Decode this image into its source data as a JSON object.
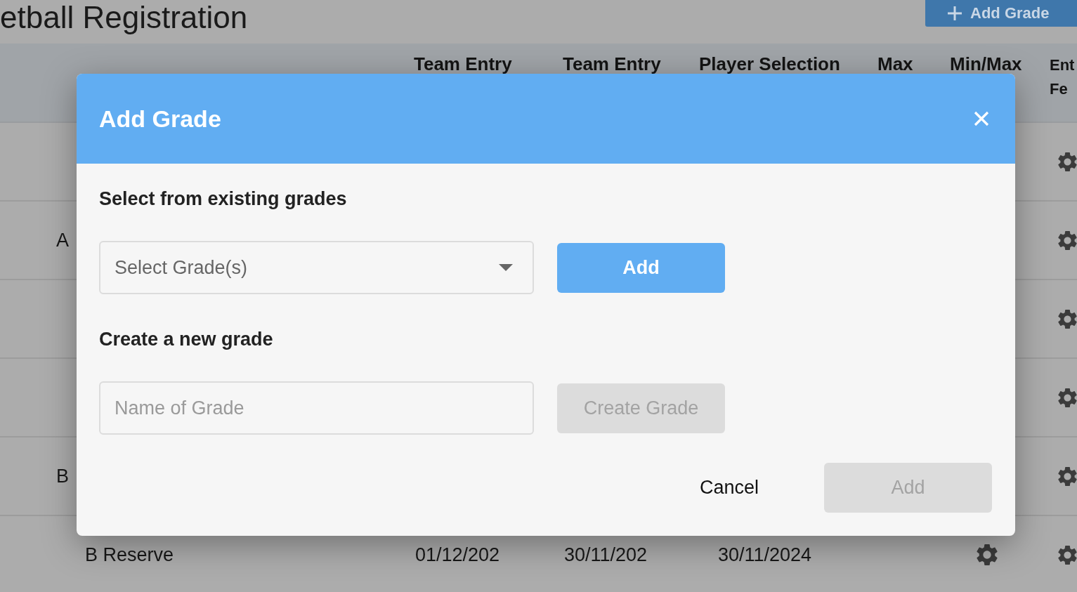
{
  "page": {
    "title": "etball Registration",
    "add_grade_button": {
      "label": "Add Grade"
    }
  },
  "table": {
    "columns": [
      {},
      {
        "lines": [
          "Team Entry"
        ]
      },
      {
        "lines": [
          "Team Entry"
        ]
      },
      {
        "lines": [
          "Player Selection"
        ]
      },
      {
        "lines": [
          "Max"
        ]
      },
      {
        "lines": [
          "Min/Max"
        ]
      },
      {
        "lines": [
          "Ent",
          "Fe"
        ]
      }
    ],
    "rows": [
      {
        "cells": [
          {
            "kind": "blank"
          },
          {
            "kind": "blank"
          },
          {
            "kind": "blank"
          },
          {
            "kind": "blank"
          },
          {
            "kind": "blank"
          },
          {
            "kind": "blank"
          },
          {
            "kind": "gear"
          }
        ]
      },
      {
        "kind": "group",
        "cells": [
          {
            "kind": "text",
            "text": "A"
          },
          {
            "kind": "blank"
          },
          {
            "kind": "blank"
          },
          {
            "kind": "blank"
          },
          {
            "kind": "blank"
          },
          {
            "kind": "blank"
          },
          {
            "kind": "gear"
          }
        ]
      },
      {
        "cells": [
          {
            "kind": "blank"
          },
          {
            "kind": "blank"
          },
          {
            "kind": "blank"
          },
          {
            "kind": "blank"
          },
          {
            "kind": "blank"
          },
          {
            "kind": "blank"
          },
          {
            "kind": "gear"
          }
        ]
      },
      {
        "cells": [
          {
            "kind": "blank"
          },
          {
            "kind": "blank"
          },
          {
            "kind": "blank"
          },
          {
            "kind": "blank"
          },
          {
            "kind": "blank"
          },
          {
            "kind": "blank"
          },
          {
            "kind": "gear"
          }
        ]
      },
      {
        "kind": "group",
        "cells": [
          {
            "kind": "text",
            "text": "B"
          },
          {
            "kind": "blank"
          },
          {
            "kind": "blank"
          },
          {
            "kind": "blank"
          },
          {
            "kind": "blank"
          },
          {
            "kind": "blank"
          },
          {
            "kind": "gear"
          }
        ]
      },
      {
        "kind": "grade",
        "cells": [
          {
            "kind": "text",
            "text": "B Reserve"
          },
          {
            "kind": "text",
            "text": "01/12/202"
          },
          {
            "kind": "text",
            "text": "30/11/202"
          },
          {
            "kind": "text",
            "text": "30/11/2024"
          },
          {
            "kind": "blank"
          },
          {
            "kind": "gear"
          },
          {
            "kind": "gear"
          }
        ]
      }
    ]
  },
  "dialog": {
    "title": "Add Grade",
    "sections": [
      {
        "heading": "Select from existing grades",
        "kind": "select",
        "field": {
          "placeholder": "Select Grade(s)"
        },
        "button": {
          "label": "Add",
          "disabled": false
        }
      },
      {
        "heading": "Create a new grade",
        "kind": "input",
        "field": {
          "placeholder": "Name of Grade"
        },
        "button": {
          "label": "Create Grade",
          "disabled": true
        }
      }
    ],
    "footer_buttons": [
      {
        "label": "Cancel",
        "kind": "text",
        "disabled": false
      },
      {
        "label": "Add",
        "kind": "filled",
        "disabled": true
      }
    ]
  }
}
